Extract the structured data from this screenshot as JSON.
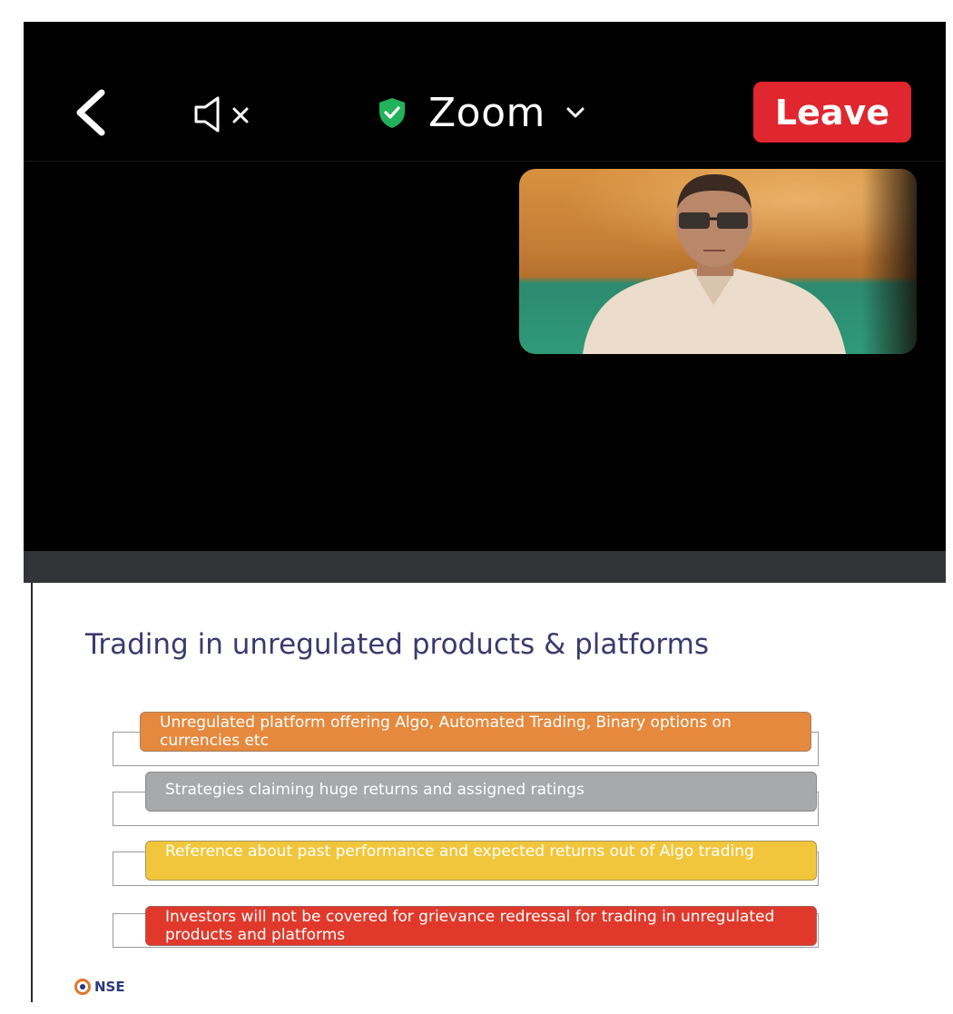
{
  "meeting": {
    "app_title": "Zoom",
    "leave_label": "Leave"
  },
  "slide": {
    "title": "Trading in unregulated products & platforms",
    "items": [
      {
        "text": "Unregulated platform offering Algo, Automated  Trading, Binary options on currencies etc",
        "color": "#e5893e"
      },
      {
        "text": "Strategies claiming huge returns and assigned ratings",
        "color": "#a8a9ab"
      },
      {
        "text": "Reference about past performance  and  expected returns out of Algo trading",
        "color": "#f2c63c"
      },
      {
        "text": "Investors will not be covered  for grievance redressal  for trading in unregulated products and platforms",
        "color": "#e0392b"
      }
    ],
    "logo_text": "NSE"
  },
  "colors": {
    "leave_red": "#e0262f",
    "shield_green": "#22b25c",
    "title_navy": "#3b3a6c"
  }
}
